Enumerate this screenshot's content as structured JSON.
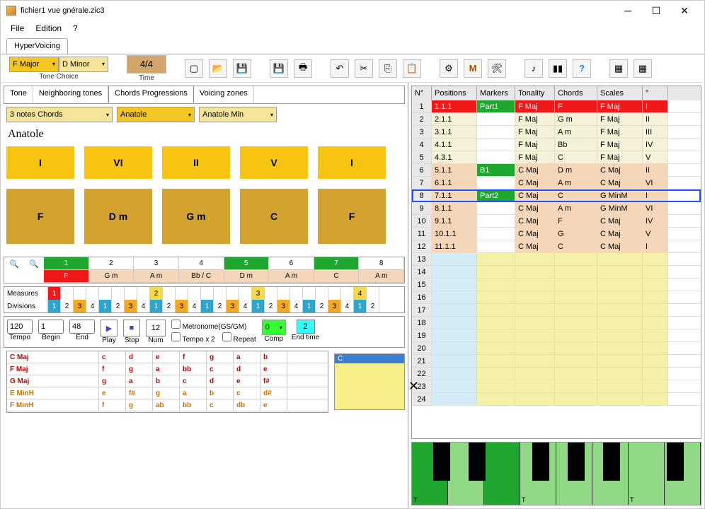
{
  "window": {
    "title": "fichier1 vue gnérale.zic3"
  },
  "menu": {
    "file": "File",
    "edition": "Edition",
    "help": "?"
  },
  "app_tab": "HyperVoicing",
  "toolbar": {
    "tone1": "F Major",
    "tone2": "D Minor",
    "tone_label": "Tone Choice",
    "time": "4/4",
    "time_label": "Time"
  },
  "subtabs": {
    "tone": "Tone",
    "neighboring": "Neighboring tones",
    "prog": "Chords Progressions",
    "zones": "Voicing zones"
  },
  "prog": {
    "chord_type": "3 notes Chords",
    "name1": "Anatole",
    "name2": "Anatole Min",
    "title": "Anatole",
    "row1": [
      "I",
      "VI",
      "II",
      "V",
      "I"
    ],
    "row2": [
      "F",
      "D m",
      "G m",
      "C",
      "F"
    ]
  },
  "ruler": {
    "bars": [
      "1",
      "2",
      "3",
      "4",
      "5",
      "6",
      "7",
      "8"
    ],
    "chords": [
      "F",
      "G m",
      "A m",
      "Bb / C",
      "D m",
      "A m",
      "C",
      "A m"
    ]
  },
  "md": {
    "measures": "Measures",
    "divisions": "Divisions",
    "m": [
      "1",
      "",
      "",
      "",
      "",
      "",
      "",
      "",
      "2",
      "",
      "",
      "",
      "",
      "",
      "",
      "",
      "3",
      "",
      "",
      "",
      "",
      "",
      "",
      "",
      "4",
      ""
    ],
    "d": [
      "1",
      "2",
      "3",
      "4",
      "1",
      "2",
      "3",
      "4",
      "1",
      "2",
      "3",
      "4",
      "1",
      "2",
      "3",
      "4",
      "1",
      "2",
      "3",
      "4",
      "1",
      "2",
      "3",
      "4",
      "1",
      "2"
    ]
  },
  "playback": {
    "tempo": "120",
    "tempo_l": "Tempo",
    "begin": "1",
    "begin_l": "Begin",
    "end": "48",
    "end_l": "End",
    "play_l": "Play",
    "stop_l": "Stop",
    "num": "12",
    "num_l": "Num",
    "metronome": "Metronome(GS/GM)",
    "tempox2": "Tempo x 2",
    "repeat": "Repeat",
    "comp": "0",
    "comp_l": "Comp",
    "endtime": "2",
    "endtime_l": "End time"
  },
  "chord_display": {
    "rows": [
      {
        "name": "C Maj",
        "notes": [
          "c",
          "d",
          "e",
          "f",
          "g",
          "a",
          "b"
        ],
        "cls": "redt"
      },
      {
        "name": "F Maj",
        "notes": [
          "f",
          "g",
          "a",
          "bb",
          "c",
          "d",
          "e"
        ],
        "cls": "redt"
      },
      {
        "name": "G Maj",
        "notes": [
          "g",
          "a",
          "b",
          "c",
          "d",
          "e",
          "f#"
        ],
        "cls": "redt"
      },
      {
        "name": "E MinH",
        "notes": [
          "e",
          "f#",
          "g",
          "a",
          "b",
          "c",
          "d#"
        ],
        "cls": "orgt"
      },
      {
        "name": "F MinH",
        "notes": [
          "f",
          "g",
          "ab",
          "bb",
          "c",
          "db",
          "e"
        ],
        "cls": "orgt"
      }
    ],
    "pad_label": "C"
  },
  "grid": {
    "headers": {
      "n": "N°",
      "pos": "Positions",
      "mk": "Markers",
      "ton": "Tonality",
      "ch": "Chords",
      "sc": "Scales",
      "deg": "°"
    },
    "rows": [
      {
        "n": "1",
        "pos": "1.1.1",
        "mk": "Part1",
        "ton": "F Maj",
        "ch": "F",
        "sc": "F Maj",
        "deg": "I",
        "style": "r1"
      },
      {
        "n": "2",
        "pos": "2.1.1",
        "mk": "",
        "ton": "F Maj",
        "ch": "G m",
        "sc": "F Maj",
        "deg": "II",
        "style": "cream"
      },
      {
        "n": "3",
        "pos": "3.1.1",
        "mk": "",
        "ton": "F Maj",
        "ch": "A m",
        "sc": "F Maj",
        "deg": "III",
        "style": "cream"
      },
      {
        "n": "4",
        "pos": "4.1.1",
        "mk": "",
        "ton": "F Maj",
        "ch": "Bb",
        "sc": "F Maj",
        "deg": "IV",
        "style": "cream"
      },
      {
        "n": "5",
        "pos": "4.3.1",
        "mk": "",
        "ton": "F Maj",
        "ch": "C",
        "sc": "F Maj",
        "deg": "V",
        "style": "cream"
      },
      {
        "n": "6",
        "pos": "5.1.1",
        "mk": "B1",
        "ton": "C Maj",
        "ch": "D m",
        "sc": "C Maj",
        "deg": "II",
        "style": "peach b1"
      },
      {
        "n": "7",
        "pos": "6.1.1",
        "mk": "",
        "ton": "C Maj",
        "ch": "A m",
        "sc": "C Maj",
        "deg": "VI",
        "style": "peach"
      },
      {
        "n": "8",
        "pos": "7.1.1",
        "mk": "Part2",
        "ton": "C Maj",
        "ch": "C",
        "sc": "G MinM",
        "deg": "I",
        "style": "peach sel"
      },
      {
        "n": "9",
        "pos": "8.1.1",
        "mk": "",
        "ton": "C Maj",
        "ch": "A m",
        "sc": "G MinM",
        "deg": "VI",
        "style": "peach"
      },
      {
        "n": "10",
        "pos": "9.1.1",
        "mk": "",
        "ton": "C Maj",
        "ch": "F",
        "sc": "C Maj",
        "deg": "IV",
        "style": "peach"
      },
      {
        "n": "11",
        "pos": "10.1.1",
        "mk": "",
        "ton": "C Maj",
        "ch": "G",
        "sc": "C Maj",
        "deg": "V",
        "style": "peach"
      },
      {
        "n": "12",
        "pos": "11.1.1",
        "mk": "",
        "ton": "C Maj",
        "ch": "C",
        "sc": "C Maj",
        "deg": "I",
        "style": "peach"
      },
      {
        "n": "13",
        "pos": "",
        "mk": "",
        "ton": "",
        "ch": "",
        "sc": "",
        "deg": "",
        "style": "empty"
      },
      {
        "n": "14",
        "pos": "",
        "mk": "",
        "ton": "",
        "ch": "",
        "sc": "",
        "deg": "",
        "style": "empty"
      },
      {
        "n": "15",
        "pos": "",
        "mk": "",
        "ton": "",
        "ch": "",
        "sc": "",
        "deg": "",
        "style": "empty"
      },
      {
        "n": "16",
        "pos": "",
        "mk": "",
        "ton": "",
        "ch": "",
        "sc": "",
        "deg": "",
        "style": "empty"
      },
      {
        "n": "17",
        "pos": "",
        "mk": "",
        "ton": "",
        "ch": "",
        "sc": "",
        "deg": "",
        "style": "empty"
      },
      {
        "n": "18",
        "pos": "",
        "mk": "",
        "ton": "",
        "ch": "",
        "sc": "",
        "deg": "",
        "style": "empty"
      },
      {
        "n": "19",
        "pos": "",
        "mk": "",
        "ton": "",
        "ch": "",
        "sc": "",
        "deg": "",
        "style": "empty"
      },
      {
        "n": "20",
        "pos": "",
        "mk": "",
        "ton": "",
        "ch": "",
        "sc": "",
        "deg": "",
        "style": "empty"
      },
      {
        "n": "21",
        "pos": "",
        "mk": "",
        "ton": "",
        "ch": "",
        "sc": "",
        "deg": "",
        "style": "empty"
      },
      {
        "n": "22",
        "pos": "",
        "mk": "",
        "ton": "",
        "ch": "",
        "sc": "",
        "deg": "",
        "style": "empty"
      },
      {
        "n": "23",
        "pos": "",
        "mk": "",
        "ton": "",
        "ch": "",
        "sc": "",
        "deg": "",
        "style": "empty"
      },
      {
        "n": "24",
        "pos": "",
        "mk": "",
        "ton": "",
        "ch": "",
        "sc": "",
        "deg": "",
        "style": "empty"
      }
    ]
  },
  "piano_label": "T"
}
